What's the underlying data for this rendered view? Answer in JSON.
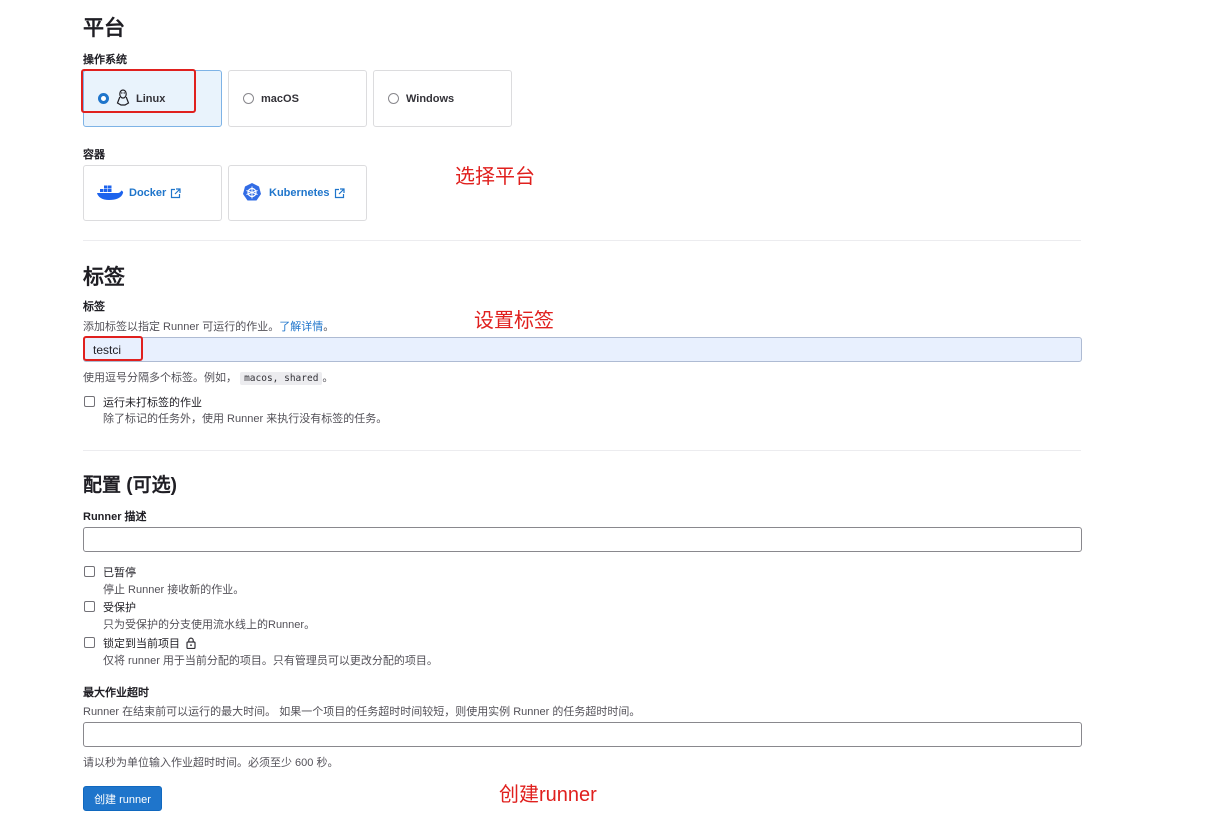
{
  "platform": {
    "heading": "平台",
    "os_label": "操作系统",
    "os_options": [
      {
        "label": "Linux",
        "selected": true
      },
      {
        "label": "macOS",
        "selected": false
      },
      {
        "label": "Windows",
        "selected": false
      }
    ],
    "container_label": "容器",
    "containers": [
      {
        "label": "Docker",
        "icon": "docker-icon"
      },
      {
        "label": "Kubernetes",
        "icon": "kubernetes-icon"
      }
    ]
  },
  "tags": {
    "heading": "标签",
    "field_label": "标签",
    "help_prefix": "添加标签以指定 Runner 可运行的作业。",
    "help_link": "了解详情",
    "help_suffix": "。",
    "value": "testci",
    "hint_prefix": "使用逗号分隔多个标签。例如，",
    "hint_code": "macos, shared",
    "hint_suffix": "。",
    "run_untagged_label": "运行未打标签的作业",
    "run_untagged_help": "除了标记的任务外，使用 Runner 来执行没有标签的任务。"
  },
  "config": {
    "heading": "配置 (可选)",
    "description_label": "Runner 描述",
    "description_value": "",
    "paused_label": "已暂停",
    "paused_help": "停止 Runner 接收新的作业。",
    "protected_label": "受保护",
    "protected_help": "只为受保护的分支使用流水线上的Runner。",
    "locked_label": "锁定到当前项目",
    "locked_help": "仅将 runner 用于当前分配的项目。只有管理员可以更改分配的项目。",
    "timeout_label": "最大作业超时",
    "timeout_desc": "Runner 在结束前可以运行的最大时间。 如果一个项目的任务超时时间较短，则使用实例 Runner 的任务超时时间。",
    "timeout_value": "",
    "timeout_hint": "请以秒为单位输入作业超时时间。必须至少 600 秒。"
  },
  "submit": {
    "label": "创建 runner"
  },
  "annotations": {
    "platform": "选择平台",
    "tags": "设置标签",
    "create": "创建runner"
  },
  "colors": {
    "accent": "#1f75cb",
    "annotation": "#e0201e"
  }
}
